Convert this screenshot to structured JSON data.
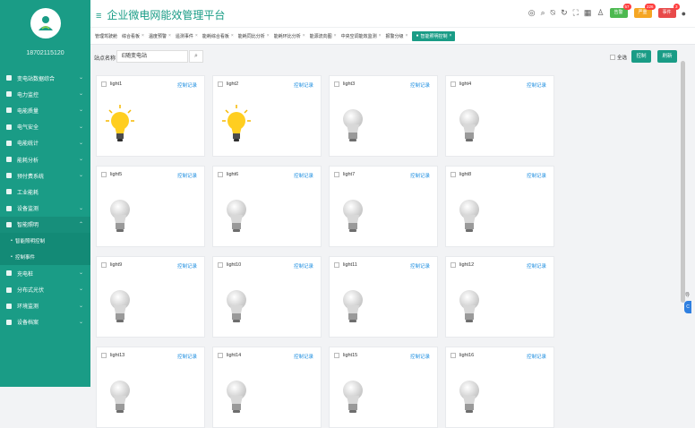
{
  "app": {
    "title": "企业微电网能效管理平台"
  },
  "user": {
    "id": "18702115120"
  },
  "sidebar": {
    "items": [
      {
        "label": "变电站数据综合",
        "icon": "home-icon"
      },
      {
        "label": "电力监控",
        "icon": "power-icon"
      },
      {
        "label": "电能质量",
        "icon": "chart-icon"
      },
      {
        "label": "电气安全",
        "icon": "safety-icon"
      },
      {
        "label": "电能统计",
        "icon": "bar-icon"
      },
      {
        "label": "能耗分析",
        "icon": "analysis-icon"
      },
      {
        "label": "预付费系统",
        "icon": "prepay-icon"
      },
      {
        "label": "工业能耗",
        "icon": "factory-icon"
      },
      {
        "label": "设备监测",
        "icon": "device-icon"
      },
      {
        "label": "智能照明",
        "icon": "light-icon"
      },
      {
        "label": "智能照明控制",
        "icon": "",
        "sub": true
      },
      {
        "label": "控制事件",
        "icon": "",
        "sub": true
      },
      {
        "label": "充电桩",
        "icon": "charge-icon"
      },
      {
        "label": "分布式光伏",
        "icon": "solar-icon"
      },
      {
        "label": "环境监测",
        "icon": "env-icon"
      },
      {
        "label": "设备档案",
        "icon": "archive-icon"
      }
    ]
  },
  "topbar": {
    "badges": [
      {
        "label": "告警",
        "count": "57",
        "color": "#4cb950"
      },
      {
        "label": "严重",
        "count": "226",
        "color": "#f5a623"
      },
      {
        "label": "事件",
        "count": "3",
        "color": "#e84a4a"
      }
    ]
  },
  "tabs": [
    {
      "label": "管理驾驶舱",
      "closable": false
    },
    {
      "label": "综合看板",
      "closable": true
    },
    {
      "label": "温度预警",
      "closable": true
    },
    {
      "label": "遥测事件",
      "closable": true
    },
    {
      "label": "能耗综合看板",
      "closable": true
    },
    {
      "label": "能耗同比分析",
      "closable": true
    },
    {
      "label": "能耗环比分析",
      "closable": true
    },
    {
      "label": "能源流向图",
      "closable": true
    },
    {
      "label": "中央空调能效监测",
      "closable": true
    },
    {
      "label": "报警分级",
      "closable": true
    },
    {
      "label": "智能照明控制",
      "closable": true,
      "active": true
    }
  ],
  "toolbar": {
    "site_label": "站点名称",
    "site_value": "E随变电站",
    "select_all": "全选",
    "control_btn": "控制",
    "refresh_btn": "刷新"
  },
  "lights": [
    {
      "name": "light1",
      "on": true
    },
    {
      "name": "light2",
      "on": true
    },
    {
      "name": "light3",
      "on": false
    },
    {
      "name": "light4",
      "on": false
    },
    {
      "name": "light5",
      "on": false
    },
    {
      "name": "light6",
      "on": false
    },
    {
      "name": "light7",
      "on": false
    },
    {
      "name": "light8",
      "on": false
    },
    {
      "name": "light9",
      "on": false
    },
    {
      "name": "light10",
      "on": false
    },
    {
      "name": "light11",
      "on": false
    },
    {
      "name": "light12",
      "on": false
    },
    {
      "name": "light13",
      "on": false
    },
    {
      "name": "light14",
      "on": false
    },
    {
      "name": "light15",
      "on": false
    },
    {
      "name": "light16",
      "on": false
    }
  ],
  "card_link_label": "控制记录",
  "side_handle": {
    "text": "导",
    "btn": "C"
  },
  "colors": {
    "accent": "#1a9c86",
    "link": "#1e8ee0"
  }
}
